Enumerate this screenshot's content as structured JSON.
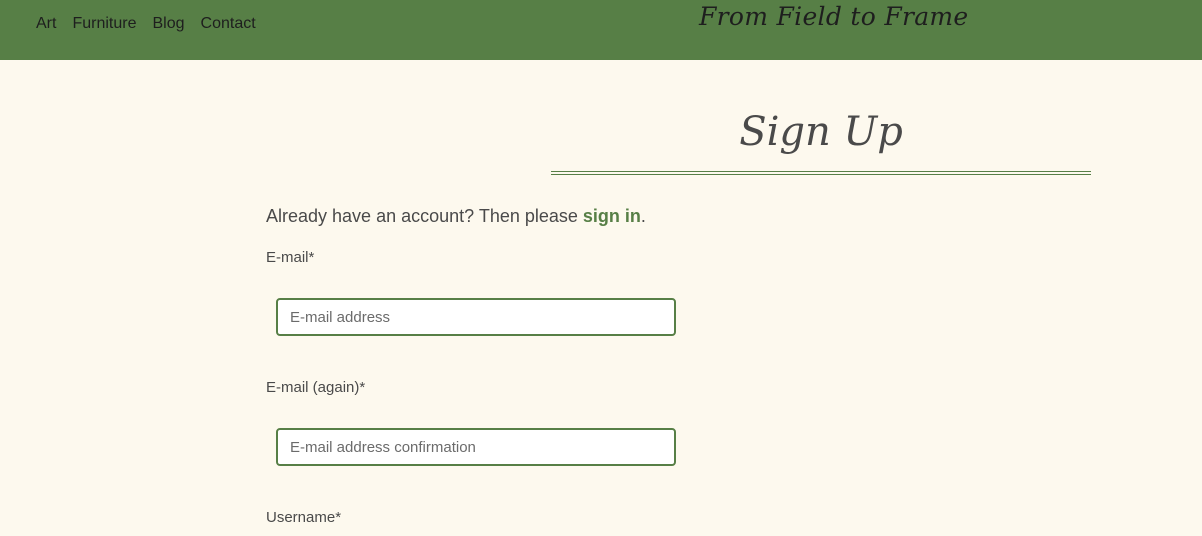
{
  "nav": {
    "items": [
      {
        "label": "Art"
      },
      {
        "label": "Furniture"
      },
      {
        "label": "Blog"
      },
      {
        "label": "Contact"
      }
    ]
  },
  "brand": {
    "name": "From Field to Frame"
  },
  "page": {
    "title": "Sign Up",
    "intro_prefix": "Already have an account? Then please ",
    "intro_link": "sign in",
    "intro_suffix": "."
  },
  "form": {
    "email": {
      "label": "E-mail*",
      "placeholder": "E-mail address",
      "value": ""
    },
    "email_again": {
      "label": "E-mail (again)*",
      "placeholder": "E-mail address confirmation",
      "value": ""
    },
    "username": {
      "label": "Username*"
    }
  },
  "colors": {
    "header_bg": "#577f46",
    "page_bg": "#fdf9ee",
    "accent": "#577f46",
    "text": "#4a4a4a"
  }
}
